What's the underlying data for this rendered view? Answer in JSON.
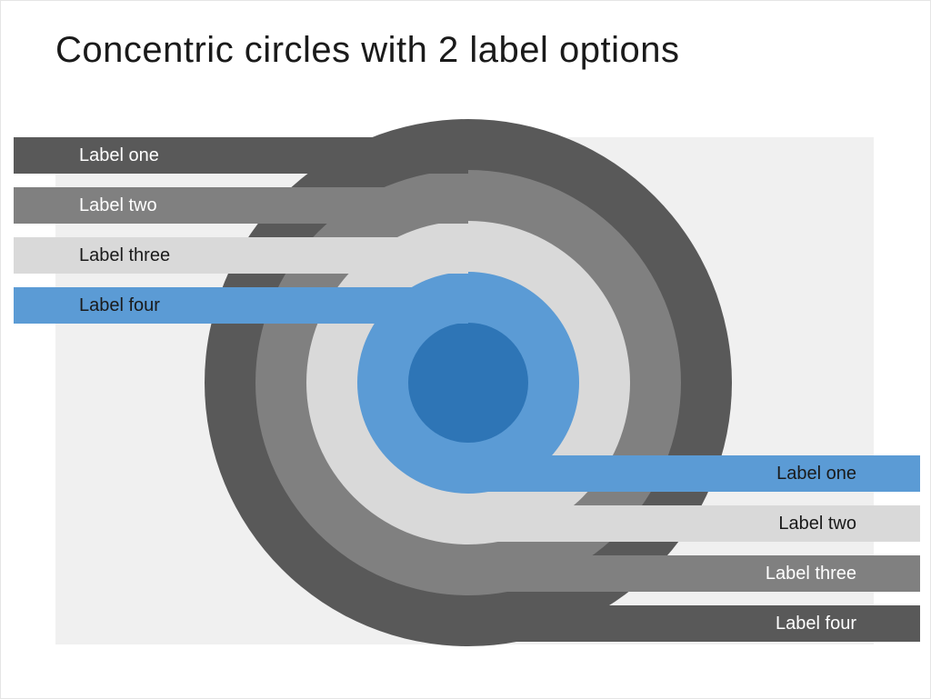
{
  "title": "Concentric circles with 2 label options",
  "colors": {
    "ring1": "#595959",
    "ring2": "#808080",
    "ring3": "#d9d9d9",
    "ring4": "#5b9bd5",
    "ring5": "#2e75b6",
    "bg": "#f0f0f0"
  },
  "left_labels": [
    {
      "text": "Label one",
      "color": "#595959",
      "textcolor": "#ffffff"
    },
    {
      "text": "Label two",
      "color": "#808080",
      "textcolor": "#ffffff"
    },
    {
      "text": "Label three",
      "color": "#d9d9d9",
      "textcolor": "#1a1a1a"
    },
    {
      "text": "Label four",
      "color": "#5b9bd5",
      "textcolor": "#1a1a1a"
    }
  ],
  "right_labels": [
    {
      "text": "Label one",
      "color": "#5b9bd5",
      "textcolor": "#1a1a1a"
    },
    {
      "text": "Label two",
      "color": "#d9d9d9",
      "textcolor": "#1a1a1a"
    },
    {
      "text": "Label three",
      "color": "#808080",
      "textcolor": "#ffffff"
    },
    {
      "text": "Label four",
      "color": "#595959",
      "textcolor": "#ffffff"
    }
  ]
}
